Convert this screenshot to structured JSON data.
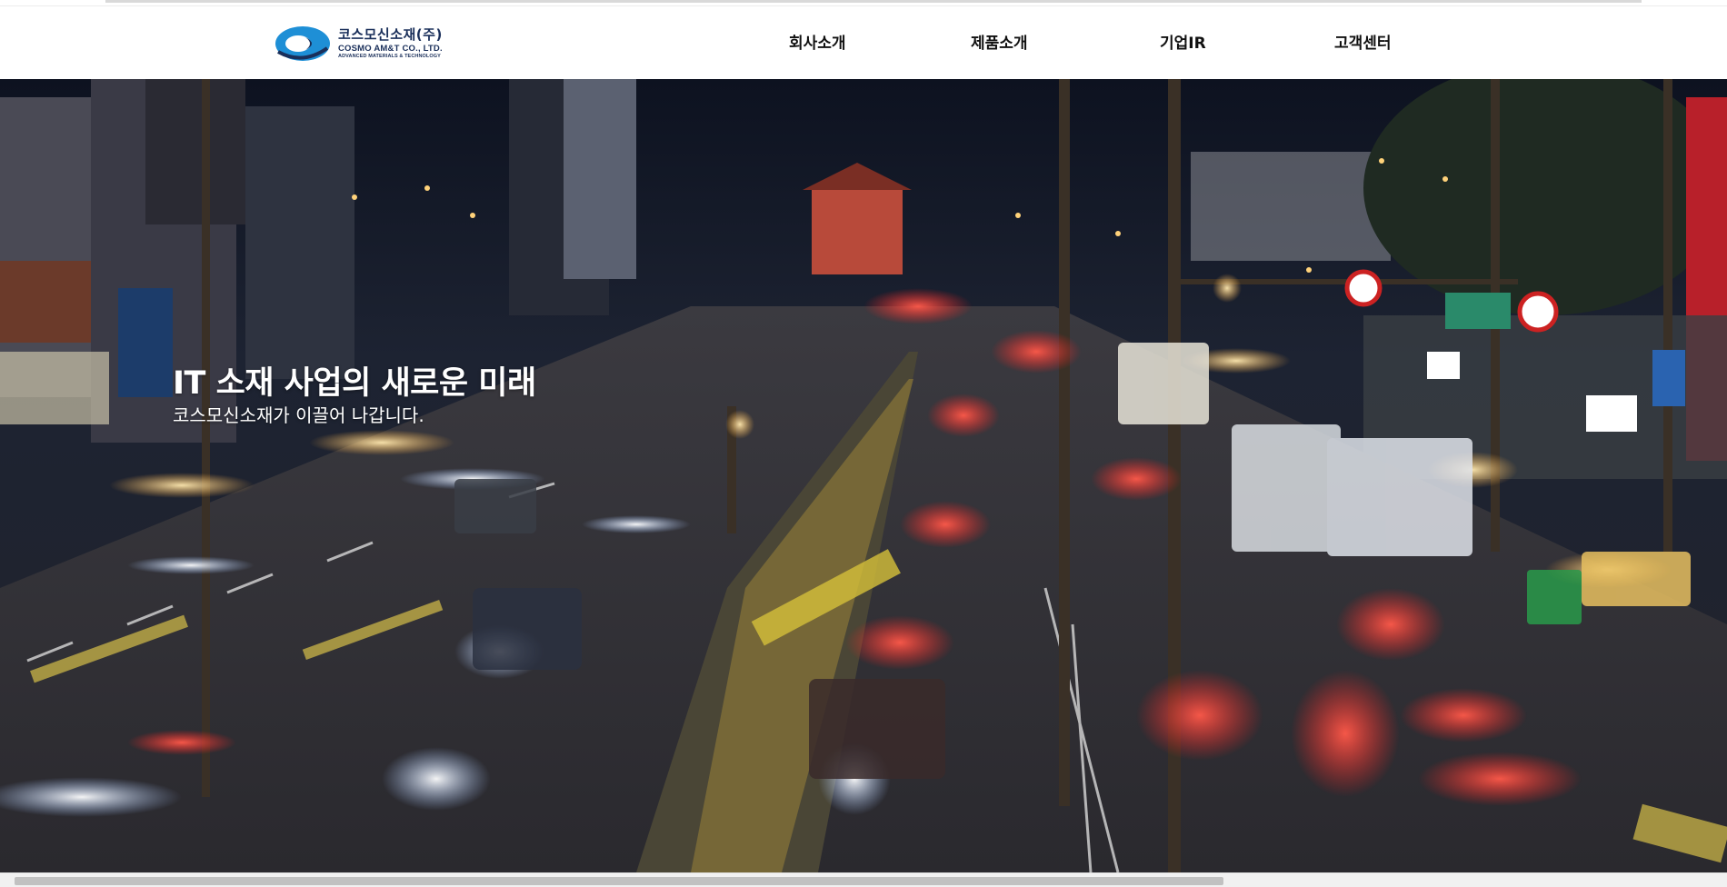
{
  "brand": {
    "name_ko": "코스모신소재(주)",
    "name_en": "COSMO AM&T CO., LTD.",
    "tagline": "ADVANCED MATERIALS & TECHNOLOGY",
    "logo_colors": {
      "blue": "#1e8fd6",
      "navy": "#1a2f5a"
    }
  },
  "nav": {
    "items": [
      {
        "label": "회사소개"
      },
      {
        "label": "제품소개"
      },
      {
        "label": "기업IR"
      },
      {
        "label": "고객센터"
      }
    ]
  },
  "hero": {
    "title": "IT 소재 사업의 새로운 미래",
    "subtitle": "코스모신소재가 이끌어 나갑니다.",
    "image_subject": "night city traffic with light trails"
  }
}
